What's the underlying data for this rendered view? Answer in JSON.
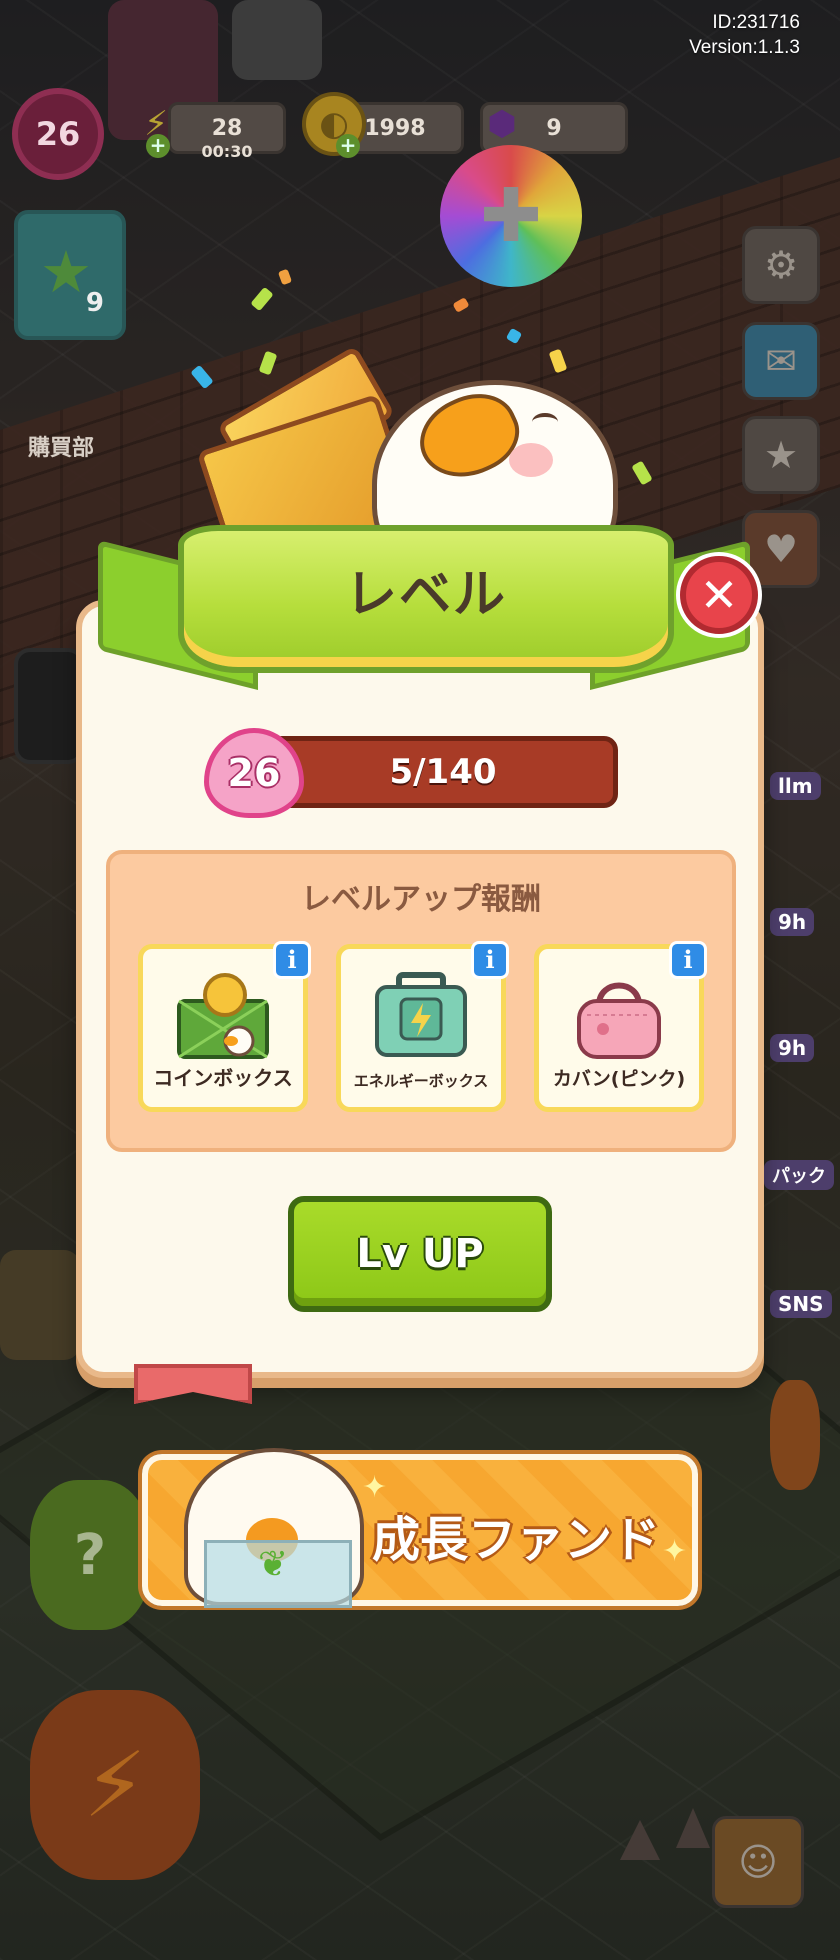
{
  "hud": {
    "user_id": "ID:231716",
    "version": "Version:1.1.3",
    "player_level": "26",
    "energy": "28",
    "energy_timer": "00:30",
    "coins": "1998",
    "gems": "9",
    "quest_count": "9",
    "shop_label": "購買部"
  },
  "side_tags": [
    "llm",
    "9h",
    "9h",
    "パック",
    "SNS"
  ],
  "modal": {
    "title": "レベル",
    "level": "26",
    "xp_text": "5/140",
    "xp_fraction": 0.036,
    "rewards_title": "レベルアップ報酬",
    "rewards": [
      {
        "label": "コインボックス",
        "icon": "coin-box-icon"
      },
      {
        "label": "エネルギーボックス",
        "icon": "energy-box-icon"
      },
      {
        "label": "カバン(ピンク)",
        "icon": "pink-bag-icon"
      }
    ],
    "lvup_label": "Lv UP"
  },
  "fund_banner": {
    "label": "成長ファンド"
  },
  "colors": {
    "ribbon_green": "#b6de3c",
    "button_green": "#8cc717",
    "xp_bar": "#a83b26",
    "close_red": "#e8444b",
    "fund_orange": "#f7a730"
  }
}
